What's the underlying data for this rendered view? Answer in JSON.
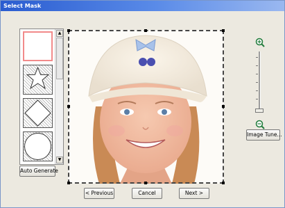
{
  "window": {
    "title": "Select Mask"
  },
  "mask_list": {
    "items": [
      {
        "shape": "rectangle",
        "selected": true
      },
      {
        "shape": "star",
        "selected": false
      },
      {
        "shape": "diamond",
        "selected": false
      },
      {
        "shape": "circle",
        "selected": false
      }
    ]
  },
  "buttons": {
    "auto_generate": "Auto Generate",
    "image_tune": "Image Tune...",
    "previous": "< Previous",
    "cancel": "Cancel",
    "next": "Next >"
  },
  "icons": {
    "zoom_in": "zoom-in-icon",
    "zoom_out": "zoom-out-icon"
  },
  "zoom": {
    "level_fraction": 0.05
  },
  "colors": {
    "title_bar": "#2a5cd0",
    "selection": "#f28a8a"
  }
}
